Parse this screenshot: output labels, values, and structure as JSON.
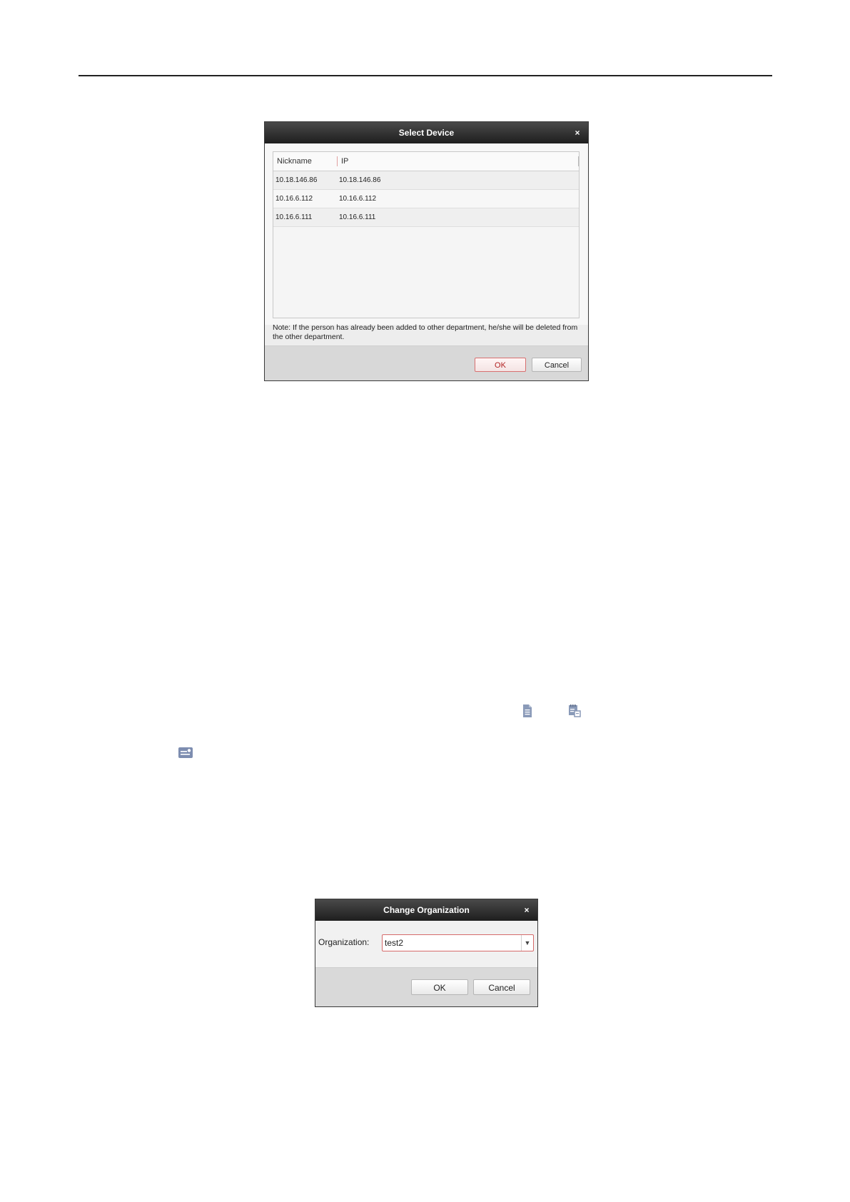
{
  "select_device": {
    "title": "Select Device",
    "close_glyph": "×",
    "columns": {
      "nickname": "Nickname",
      "ip": "IP"
    },
    "rows": [
      {
        "nickname": "10.18.146.86",
        "ip": "10.18.146.86"
      },
      {
        "nickname": "10.16.6.112",
        "ip": "10.16.6.112"
      },
      {
        "nickname": "10.16.6.111",
        "ip": "10.16.6.111"
      }
    ],
    "note": "Note: If the person has already been added to other department, he/she will be deleted from the other department.",
    "ok_label": "OK",
    "cancel_label": "Cancel"
  },
  "icons": {
    "doc": "document-icon",
    "doc_card": "document-card-icon",
    "change_org": "change-organization-icon",
    "color": "#8a9ab8"
  },
  "change_org": {
    "title": "Change Organization",
    "close_glyph": "×",
    "label": "Organization:",
    "selected": "test2",
    "ok_label": "OK",
    "cancel_label": "Cancel"
  },
  "colors": {
    "title_bar": "#2a2a2a",
    "accent_border": "#d66a6a"
  }
}
